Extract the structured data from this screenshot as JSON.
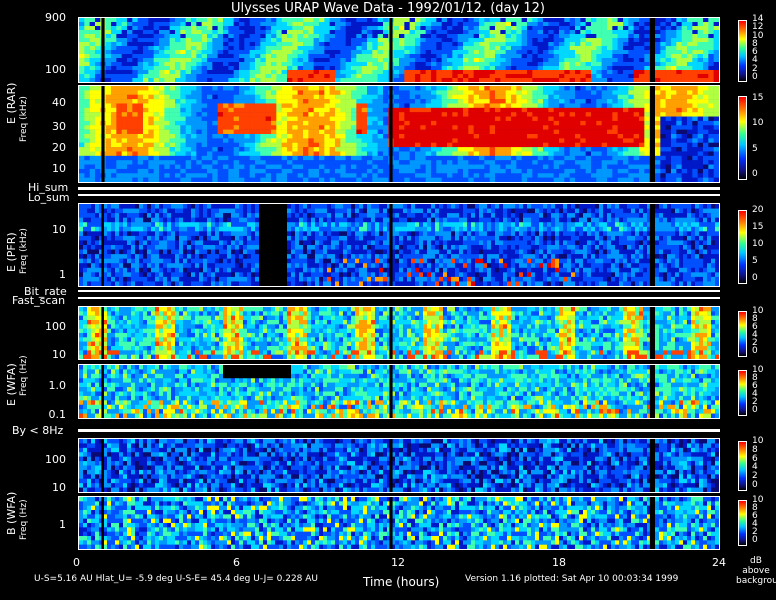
{
  "title": "Ulysses URAP Wave Data - 1992/01/12. (day 12)",
  "panels": {
    "rar": {
      "label": "E (RAR)",
      "freq_label": "Freq (kHz)",
      "ticks_high": [
        "900",
        "100"
      ],
      "ticks_low": [
        "40",
        "30",
        "20",
        "10"
      ]
    },
    "pfr": {
      "label": "E (PFR)",
      "freq_label": "Freq (kHz)",
      "ticks": [
        "10",
        "1"
      ]
    },
    "wfa_e": {
      "label": "E (WFA)",
      "freq_label": "Freq (Hz)",
      "ticks_high": [
        "100",
        "10"
      ],
      "ticks_low": [
        "1.0",
        "0.1"
      ]
    },
    "wfa_b": {
      "label": "B (WFA)",
      "freq_label": "Freq (Hz)",
      "ticks_high": [
        "100",
        "10"
      ],
      "ticks_low": [
        "1"
      ]
    }
  },
  "strips": {
    "hi_sum": "Hi_sum",
    "lo_sum": "Lo_sum",
    "bit_rate": "Bit_rate",
    "fast_scan": "Fast_scan",
    "by": "By < 8Hz"
  },
  "colorbars": {
    "rar_high": [
      "14",
      "12",
      "10",
      "8",
      "6",
      "4",
      "2",
      "0"
    ],
    "rar_low": [
      "15",
      "10",
      "5",
      "0"
    ],
    "pfr": [
      "20",
      "15",
      "10",
      "5",
      "0"
    ],
    "wfa_e_high": [
      "10",
      "8",
      "6",
      "4",
      "2",
      "0"
    ],
    "wfa_e_low": [
      "10",
      "8",
      "6",
      "4",
      "2",
      "0"
    ],
    "wfa_b_high": [
      "10",
      "8",
      "6",
      "4",
      "2",
      "0"
    ],
    "wfa_b_low": [
      "10",
      "8",
      "6",
      "4",
      "2",
      "0"
    ],
    "unit_lines": [
      "dB",
      "above",
      "background"
    ]
  },
  "x_axis": {
    "label": "Time (hours)",
    "ticks": [
      "0",
      "6",
      "12",
      "18",
      "24"
    ]
  },
  "footer": {
    "left": "U-S=5.16 AU   Hlat_U= -5.9 deg   U-S-E= 45.4 deg   U-J= 0.228 AU",
    "right": "Version 1.16 plotted: Sat Apr 10 00:03:34 1999"
  },
  "chart_data": {
    "type": "heatmap",
    "title": "Ulysses URAP Wave Data - 1992/01/12. (day 12)",
    "xlabel": "Time (hours)",
    "xlim": [
      0,
      24
    ],
    "x_ticks": [
      0,
      6,
      12,
      18,
      24
    ],
    "colorbar_unit": "dB above background",
    "panels": [
      {
        "name": "E (RAR)",
        "ylabel": "Freq (kHz)",
        "y_scale": "log",
        "y_ticks": [
          10,
          20,
          30,
          40,
          100,
          900
        ],
        "colorbar_range": [
          0,
          15
        ]
      },
      {
        "name": "E (PFR)",
        "ylabel": "Freq (kHz)",
        "y_scale": "log",
        "y_ticks": [
          1,
          10
        ],
        "colorbar_range": [
          0,
          20
        ]
      },
      {
        "name": "E (WFA)",
        "ylabel": "Freq (Hz)",
        "y_scale": "log",
        "y_ticks": [
          0.1,
          1.0,
          10,
          100
        ],
        "colorbar_range": [
          0,
          10
        ]
      },
      {
        "name": "B (WFA)",
        "ylabel": "Freq (Hz)",
        "y_scale": "log",
        "y_ticks": [
          1,
          10,
          100
        ],
        "colorbar_range": [
          0,
          10
        ]
      }
    ]
  }
}
